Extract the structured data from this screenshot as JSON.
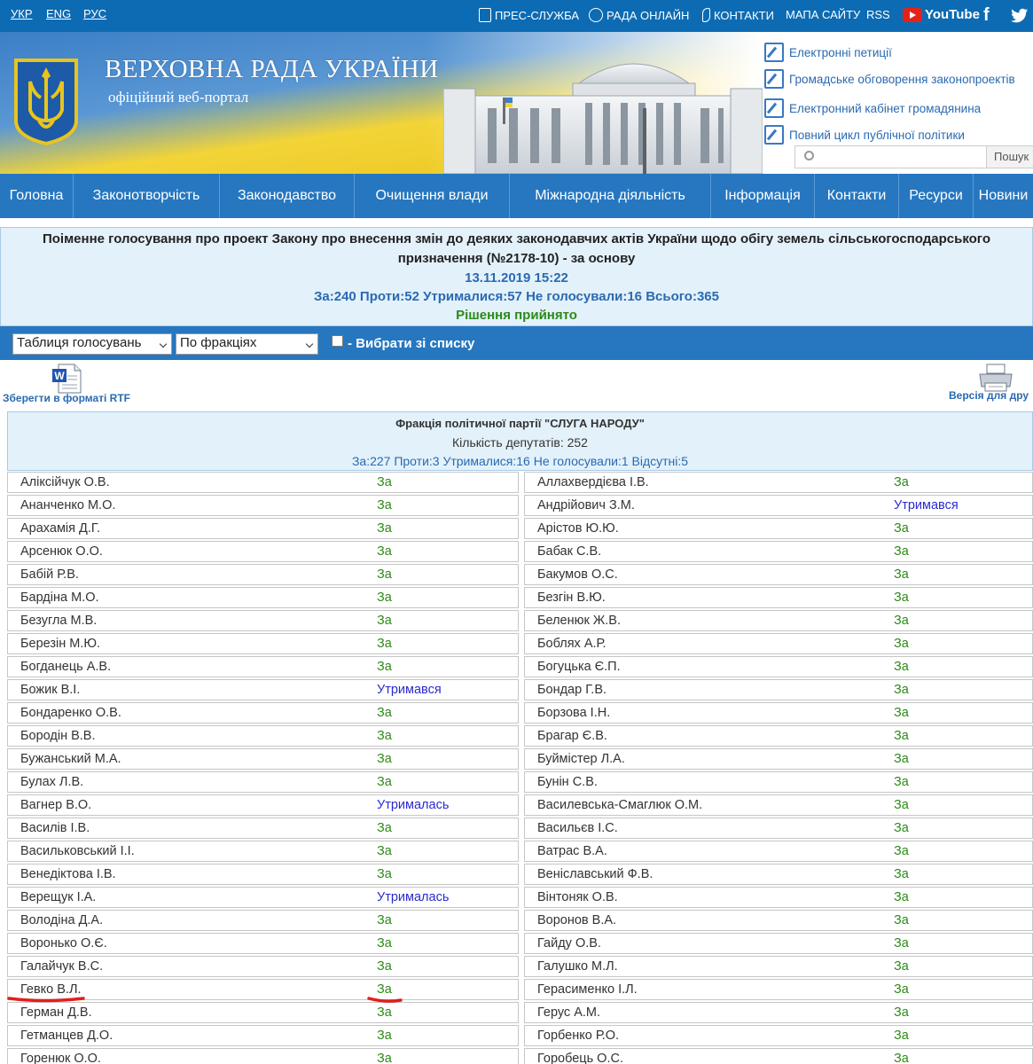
{
  "topbar": {
    "languages": [
      "УКР",
      "ENG",
      "РУС"
    ],
    "links": [
      "ПРЕС-СЛУЖБА",
      "РАДА ОНЛАЙН",
      "КОНТАКТИ",
      "МАПА САЙТУ",
      "RSS"
    ],
    "youtube_label": "YouTube",
    "facebook": "f"
  },
  "banner": {
    "title": "ВЕРХОВНА РАДА УКРАЇНИ",
    "subtitle": "офіційний веб-портал",
    "links": [
      "Електронні петиції",
      "Громадське обговорення законопроектів",
      "Електронний кабінет громадянина",
      "Повний цикл публічної політики"
    ],
    "search_button": "Пошук",
    "search_value": ""
  },
  "nav": [
    "Головна",
    "Законотворчість",
    "Законодавство",
    "Очищення влади",
    "Міжнародна діяльність",
    "Інформація",
    "Контакти",
    "Ресурси",
    "Новини"
  ],
  "vote": {
    "title": "Поіменне голосування про проект Закону про внесення змін до деяких законодавчих актів України щодо обігу земель сільськогосподарського призначення (№2178-10) - за основу",
    "datetime": "13.11.2019 15:22",
    "summary": "За:240 Проти:52 Утрималися:57 Не голосували:16 Всього:365",
    "result": "Рішення прийнято"
  },
  "controls": {
    "table_select": "Таблиця голосувань",
    "group_select": "По фракціях",
    "pick_label": "- Вибрати зі списку"
  },
  "tools": {
    "save_rtf": "Зберегти в форматі RTF",
    "print_version": "Версія для дру"
  },
  "faction": {
    "name": "Фракція політичної партії \"СЛУГА НАРОДУ\"",
    "count": "Кількість депутатів: 252",
    "summary": "За:227 Проти:3 Утрималися:16 Не голосували:1 Відсутні:5"
  },
  "colors": {
    "vote_for": "#2c8a17",
    "abstain": "#2a2ad0",
    "underline": "#e0201c"
  },
  "deputies": [
    {
      "name": "Аліксійчук О.В.",
      "vote": "За",
      "kind": "za"
    },
    {
      "name": "Аллахвердієва І.В.",
      "vote": "За",
      "kind": "za"
    },
    {
      "name": "Ананченко М.О.",
      "vote": "За",
      "kind": "za"
    },
    {
      "name": "Андрійович З.М.",
      "vote": "Утримався",
      "kind": "abs"
    },
    {
      "name": "Арахамія Д.Г.",
      "vote": "За",
      "kind": "za"
    },
    {
      "name": "Арістов Ю.Ю.",
      "vote": "За",
      "kind": "za"
    },
    {
      "name": "Арсенюк О.О.",
      "vote": "За",
      "kind": "za"
    },
    {
      "name": "Бабак С.В.",
      "vote": "За",
      "kind": "za"
    },
    {
      "name": "Бабій Р.В.",
      "vote": "За",
      "kind": "za"
    },
    {
      "name": "Бакумов О.С.",
      "vote": "За",
      "kind": "za"
    },
    {
      "name": "Бардіна М.О.",
      "vote": "За",
      "kind": "za"
    },
    {
      "name": "Безгін В.Ю.",
      "vote": "За",
      "kind": "za"
    },
    {
      "name": "Безугла М.В.",
      "vote": "За",
      "kind": "za"
    },
    {
      "name": "Беленюк Ж.В.",
      "vote": "За",
      "kind": "za"
    },
    {
      "name": "Березін М.Ю.",
      "vote": "За",
      "kind": "za"
    },
    {
      "name": "Боблях А.Р.",
      "vote": "За",
      "kind": "za"
    },
    {
      "name": "Богданець А.В.",
      "vote": "За",
      "kind": "za"
    },
    {
      "name": "Богуцька Є.П.",
      "vote": "За",
      "kind": "za"
    },
    {
      "name": "Божик В.І.",
      "vote": "Утримався",
      "kind": "abs"
    },
    {
      "name": "Бондар Г.В.",
      "vote": "За",
      "kind": "za"
    },
    {
      "name": "Бондаренко О.В.",
      "vote": "За",
      "kind": "za"
    },
    {
      "name": "Борзова І.Н.",
      "vote": "За",
      "kind": "za"
    },
    {
      "name": "Бородін В.В.",
      "vote": "За",
      "kind": "za"
    },
    {
      "name": "Брагар Є.В.",
      "vote": "За",
      "kind": "za"
    },
    {
      "name": "Бужанський М.А.",
      "vote": "За",
      "kind": "za"
    },
    {
      "name": "Буймістер Л.А.",
      "vote": "За",
      "kind": "za"
    },
    {
      "name": "Булах Л.В.",
      "vote": "За",
      "kind": "za"
    },
    {
      "name": "Бунін С.В.",
      "vote": "За",
      "kind": "za"
    },
    {
      "name": "Вагнер В.О.",
      "vote": "Утрималась",
      "kind": "abs"
    },
    {
      "name": "Василевська-Смаглюк О.М.",
      "vote": "За",
      "kind": "za"
    },
    {
      "name": "Василів І.В.",
      "vote": "За",
      "kind": "za"
    },
    {
      "name": "Васильєв І.С.",
      "vote": "За",
      "kind": "za"
    },
    {
      "name": "Васильковський І.І.",
      "vote": "За",
      "kind": "za"
    },
    {
      "name": "Ватрас В.А.",
      "vote": "За",
      "kind": "za"
    },
    {
      "name": "Венедіктова І.В.",
      "vote": "За",
      "kind": "za"
    },
    {
      "name": "Веніславський Ф.В.",
      "vote": "За",
      "kind": "za"
    },
    {
      "name": "Верещук І.А.",
      "vote": "Утрималась",
      "kind": "abs"
    },
    {
      "name": "Вінтоняк О.В.",
      "vote": "За",
      "kind": "za"
    },
    {
      "name": "Володіна Д.А.",
      "vote": "За",
      "kind": "za"
    },
    {
      "name": "Воронов В.А.",
      "vote": "За",
      "kind": "za"
    },
    {
      "name": "Воронько О.Є.",
      "vote": "За",
      "kind": "za"
    },
    {
      "name": "Гайду О.В.",
      "vote": "За",
      "kind": "za"
    },
    {
      "name": "Галайчук В.С.",
      "vote": "За",
      "kind": "za"
    },
    {
      "name": "Галушко М.Л.",
      "vote": "За",
      "kind": "za"
    },
    {
      "name": "Гевко В.Л.",
      "vote": "За",
      "kind": "za"
    },
    {
      "name": "Герасименко І.Л.",
      "vote": "За",
      "kind": "za"
    },
    {
      "name": "Герман Д.В.",
      "vote": "За",
      "kind": "za"
    },
    {
      "name": "Герус А.М.",
      "vote": "За",
      "kind": "za"
    },
    {
      "name": "Гетманцев Д.О.",
      "vote": "За",
      "kind": "za"
    },
    {
      "name": "Горбенко Р.О.",
      "vote": "За",
      "kind": "za"
    },
    {
      "name": "Горенюк О.О.",
      "vote": "За",
      "kind": "za"
    },
    {
      "name": "Горобець О.С.",
      "vote": "За",
      "kind": "za"
    }
  ]
}
